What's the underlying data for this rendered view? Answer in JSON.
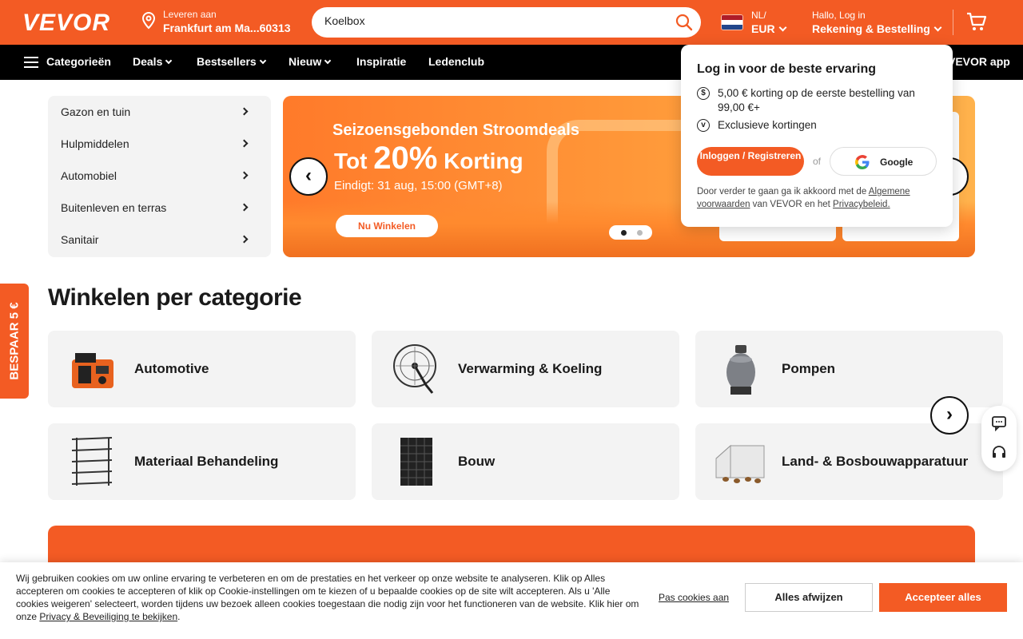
{
  "brand": {
    "logo": "VEVOR",
    "accent": "#f35b24"
  },
  "header": {
    "deliver_label": "Leveren aan",
    "deliver_location": "Frankfurt am Ma...60313",
    "search_value": "Koelbox",
    "lang": "NL/",
    "currency": "EUR",
    "greeting": "Hallo, Log in",
    "account": "Rekening & Bestelling"
  },
  "nav": {
    "items": [
      "Categorieën",
      "Deals",
      "Bestsellers",
      "Nieuw",
      "Inspiratie",
      "Ledenclub"
    ],
    "app": "VEVOR app"
  },
  "sidebar": {
    "items": [
      "Gazon en tuin",
      "Hulpmiddelen",
      "Automobiel",
      "Buitenleven en terras",
      "Sanitair"
    ]
  },
  "banner": {
    "line1": "Seizoensgebonden Stroomdeals",
    "prefix": "Tot ",
    "percent": "20%",
    "suffix": " Korting",
    "ends": "Eindigt: 31 aug, 15:00 (GMT+8)",
    "cta": "Nu Winkelen",
    "prev": "‹",
    "next": "›"
  },
  "categories": {
    "title": "Winkelen per categorie",
    "items": [
      "Automotive",
      "Verwarming & Koeling",
      "Pompen",
      "Materiaal Behandeling",
      "Bouw",
      "Land- & Bosbouwapparatuur"
    ],
    "next": "›"
  },
  "side_tab": "BESPAAR 5 €",
  "login_popup": {
    "title": "Log in voor de beste ervaring",
    "perk1": "5,00 € korting op de eerste bestelling van 99,00 €+",
    "perk2": "Exclusieve kortingen",
    "login": "Inloggen / Registreren",
    "or": "of",
    "google": "Google",
    "legal_prefix": "Door verder te gaan ga ik akkoord met de ",
    "legal_link1": "Algemene voorwaarden",
    "legal_mid": " van VEVOR en het ",
    "legal_link2": "Privacybeleid."
  },
  "cookie": {
    "text": "Wij gebruiken cookies om uw online ervaring te verbeteren en om de prestaties en het verkeer op onze website te analyseren. Klik op Alles accepteren om cookies te accepteren of klik op Cookie-instellingen om te kiezen of u bepaalde cookies op de site wilt accepteren. Als u 'Alle cookies weigeren' selecteert, worden tijdens uw bezoek alleen cookies toegestaan die nodig zijn voor het functioneren van de website. Klik hier om onze ",
    "link": "Privacy & Beveiliging te bekijken",
    "end": ".",
    "customize": "Pas cookies aan",
    "reject": "Alles afwijzen",
    "accept": "Accepteer alles"
  }
}
